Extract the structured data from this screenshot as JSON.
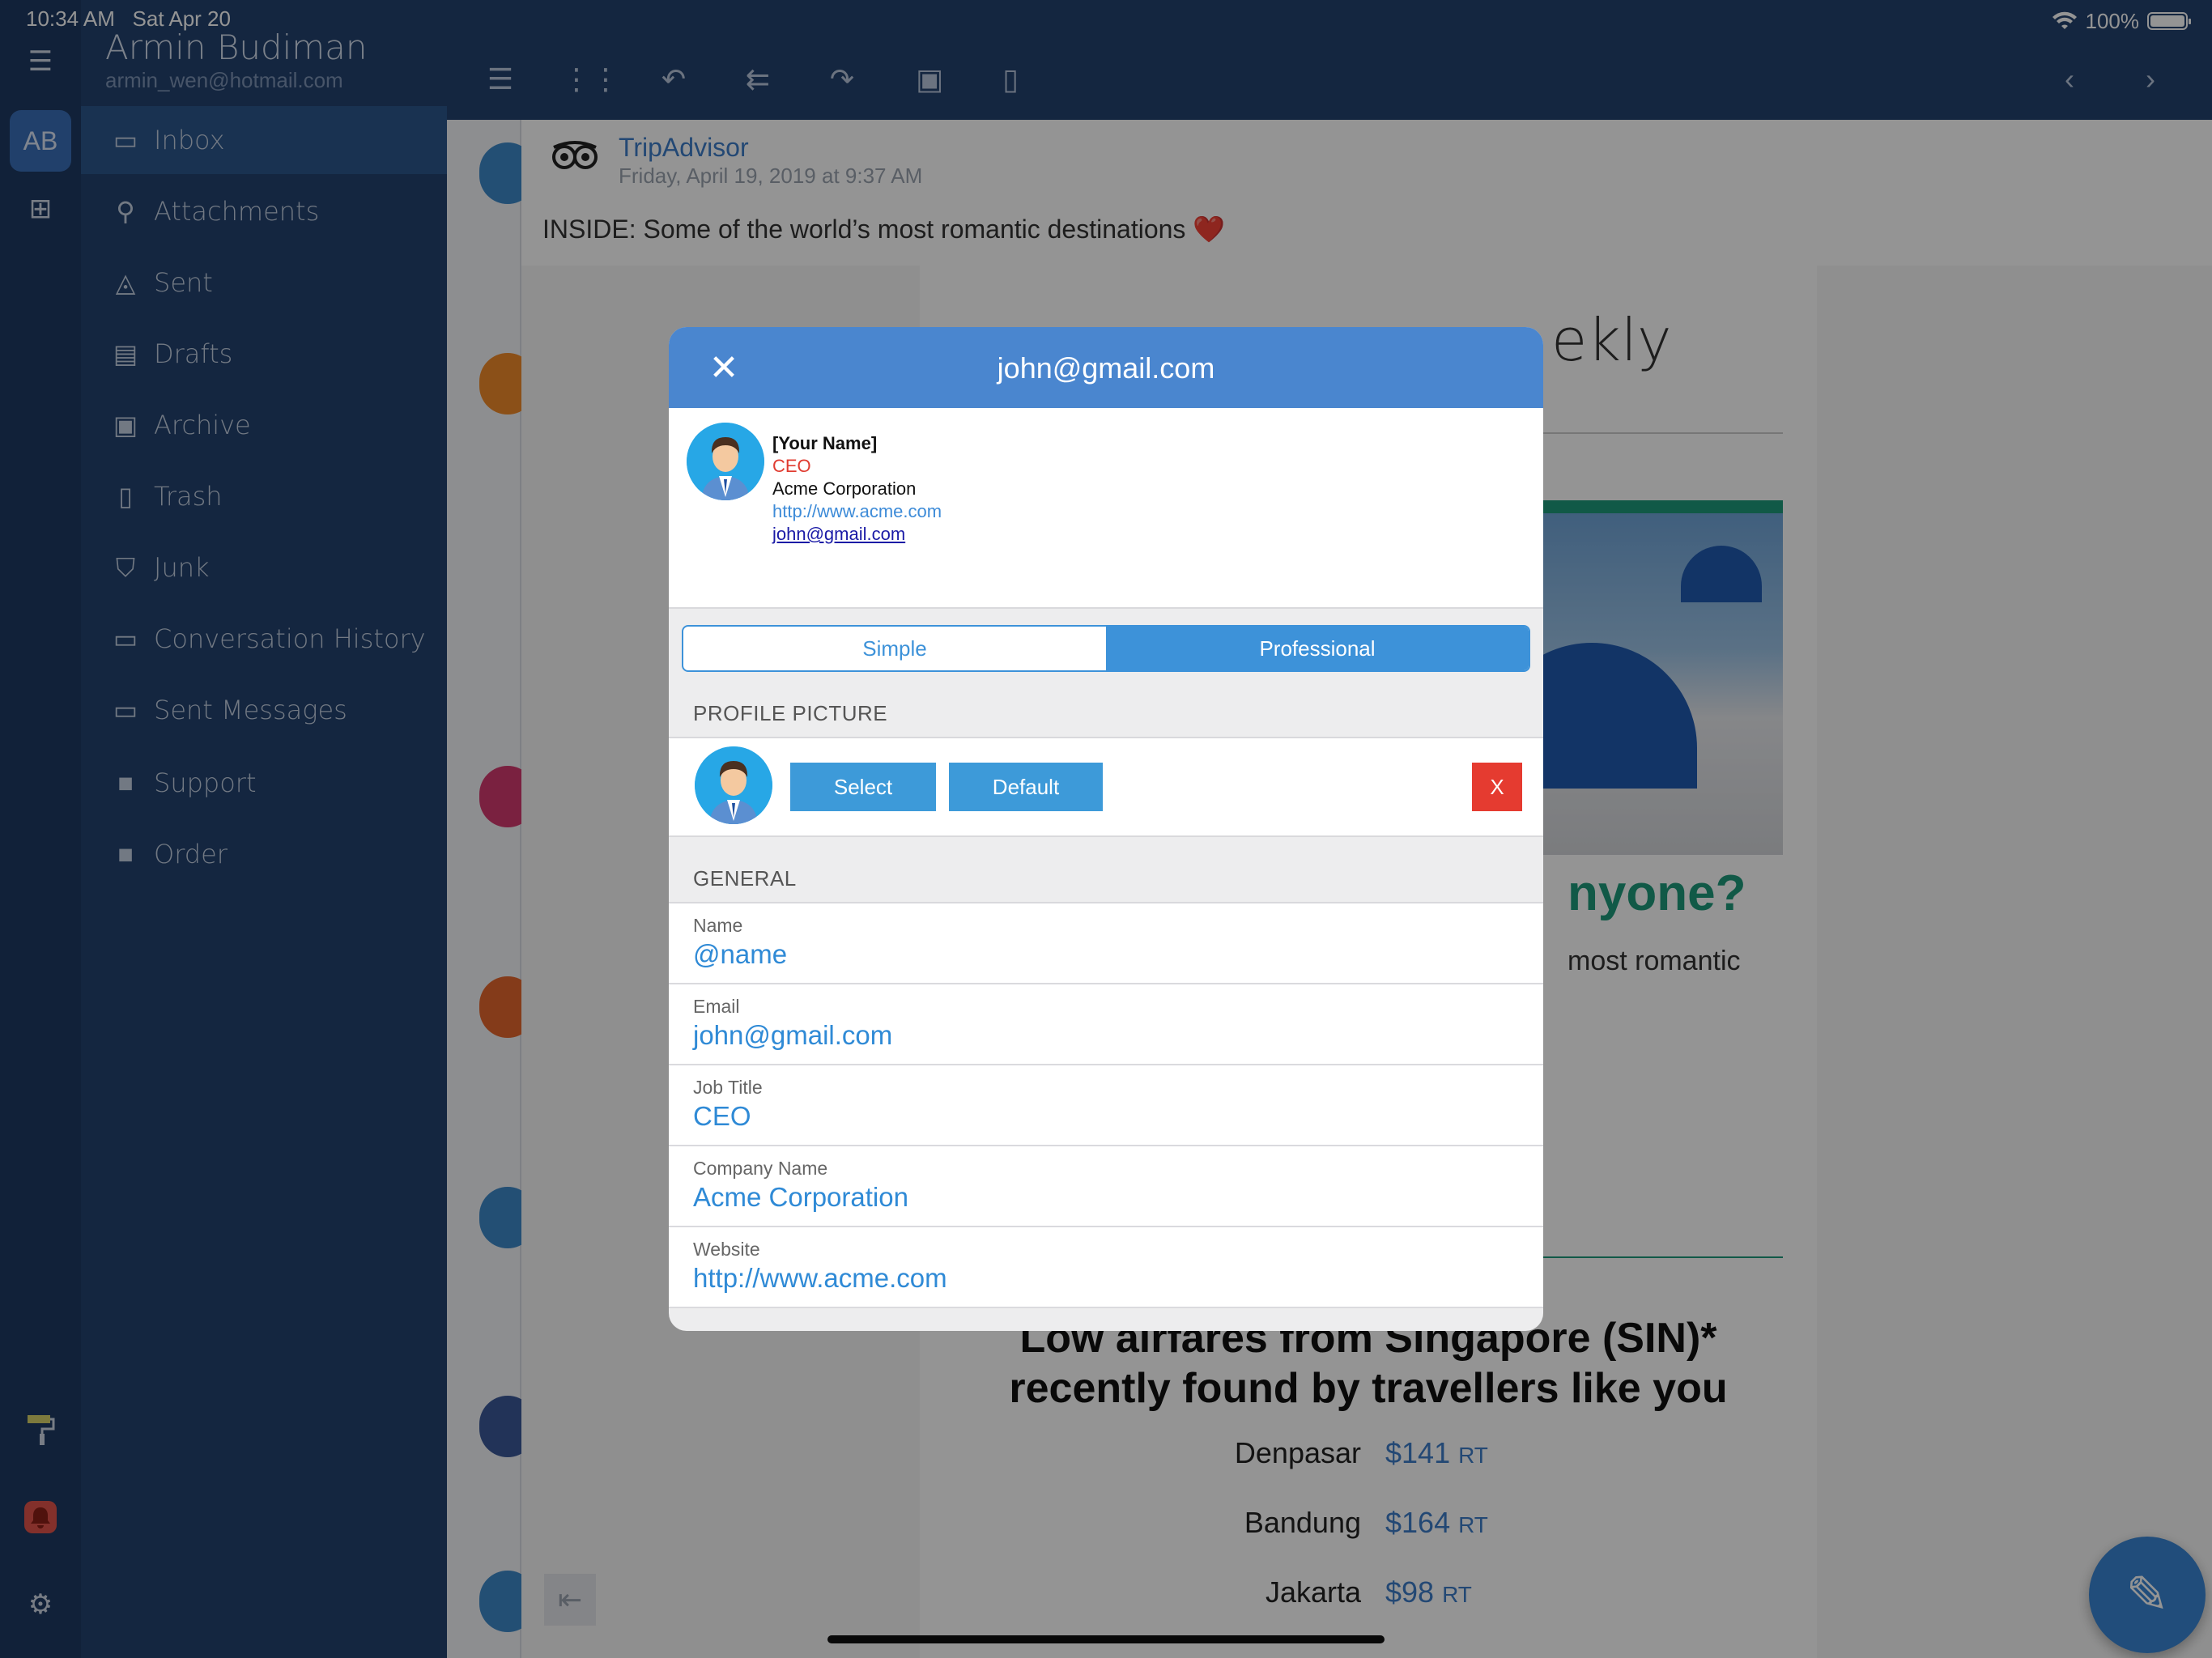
{
  "status_bar": {
    "time": "10:34 AM",
    "date": "Sat Apr 20",
    "battery": "100%"
  },
  "account": {
    "initials": "AB",
    "name": "Armin Budiman",
    "email": "armin_wen@hotmail.com"
  },
  "folders": [
    {
      "label": "Inbox",
      "icon": "inbox-icon"
    },
    {
      "label": "Attachments",
      "icon": "paperclip-icon"
    },
    {
      "label": "Sent",
      "icon": "send-icon"
    },
    {
      "label": "Drafts",
      "icon": "draft-icon"
    },
    {
      "label": "Archive",
      "icon": "archive-icon"
    },
    {
      "label": "Trash",
      "icon": "trash-icon"
    },
    {
      "label": "Junk",
      "icon": "junk-shield-icon"
    },
    {
      "label": "Conversation History",
      "icon": "folder-icon"
    },
    {
      "label": "Sent Messages",
      "icon": "folder-icon"
    },
    {
      "label": "Support",
      "icon": "tag-icon"
    },
    {
      "label": "Order",
      "icon": "tag-icon"
    }
  ],
  "email": {
    "sender": "TripAdvisor",
    "date": "Friday, April 19, 2019 at 9:37 AM",
    "subject": "INSIDE: Some of the world’s most romantic destinations ❤️",
    "newsletter": {
      "heading_fragment": "ekly",
      "question_fragment": "nyone?",
      "text_fragment": "most romantic",
      "airfares_line1": "Low airfares from Singapore (SIN)*",
      "airfares_line2": "recently found by travellers like you",
      "fares": [
        {
          "city": "Denpasar",
          "price": "$141",
          "unit": "RT"
        },
        {
          "city": "Bandung",
          "price": "$164",
          "unit": "RT"
        },
        {
          "city": "Jakarta",
          "price": "$98",
          "unit": "RT"
        }
      ]
    }
  },
  "modal": {
    "title": "john@gmail.com",
    "signature": {
      "name": "[Your Name]",
      "title": "CEO",
      "company": "Acme Corporation",
      "website": "http://www.acme.com",
      "email": "john@gmail.com"
    },
    "segments": {
      "simple": "Simple",
      "professional": "Professional",
      "selected": "Professional"
    },
    "profile_picture": {
      "section": "PROFILE PICTURE",
      "select_label": "Select",
      "default_label": "Default",
      "remove_label": "X"
    },
    "general": {
      "section": "GENERAL",
      "fields": [
        {
          "label": "Name",
          "value": "@name"
        },
        {
          "label": "Email",
          "value": "john@gmail.com"
        },
        {
          "label": "Job Title",
          "value": "CEO"
        },
        {
          "label": "Company Name",
          "value": "Acme Corporation"
        },
        {
          "label": "Website",
          "value": "http://www.acme.com"
        }
      ]
    }
  },
  "colors": {
    "header_blue": "#4a86cf",
    "accent_blue": "#3d92d9",
    "danger_red": "#e53b30",
    "sidebar_navy": "#23426e"
  }
}
